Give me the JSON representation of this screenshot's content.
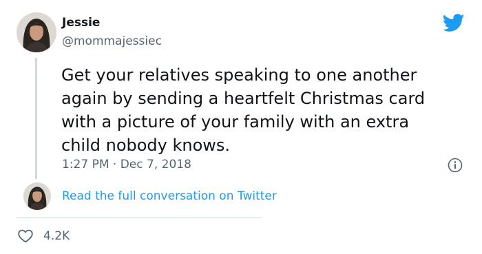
{
  "author": {
    "name": "Jessie",
    "handle": "@mommajessiec",
    "avatar_icon": "profile-photo"
  },
  "brand": {
    "icon": "twitter-bird-icon",
    "color": "#1d9bf0"
  },
  "tweet": {
    "lines": [
      "Get your relatives speaking to one another",
      "again by sending a heartfelt Christmas card",
      "with a picture of your family with an extra",
      "child nobody knows."
    ],
    "timestamp": "1:27 PM · Dec 7, 2018"
  },
  "conversation": {
    "link_text": "Read the full conversation on Twitter"
  },
  "actions": {
    "like_icon": "heart-icon",
    "like_count": "4.2K"
  },
  "colors": {
    "text": "#0f1419",
    "secondary_text": "#536471",
    "link": "#1d9bf0",
    "divider": "#cfd9de"
  }
}
